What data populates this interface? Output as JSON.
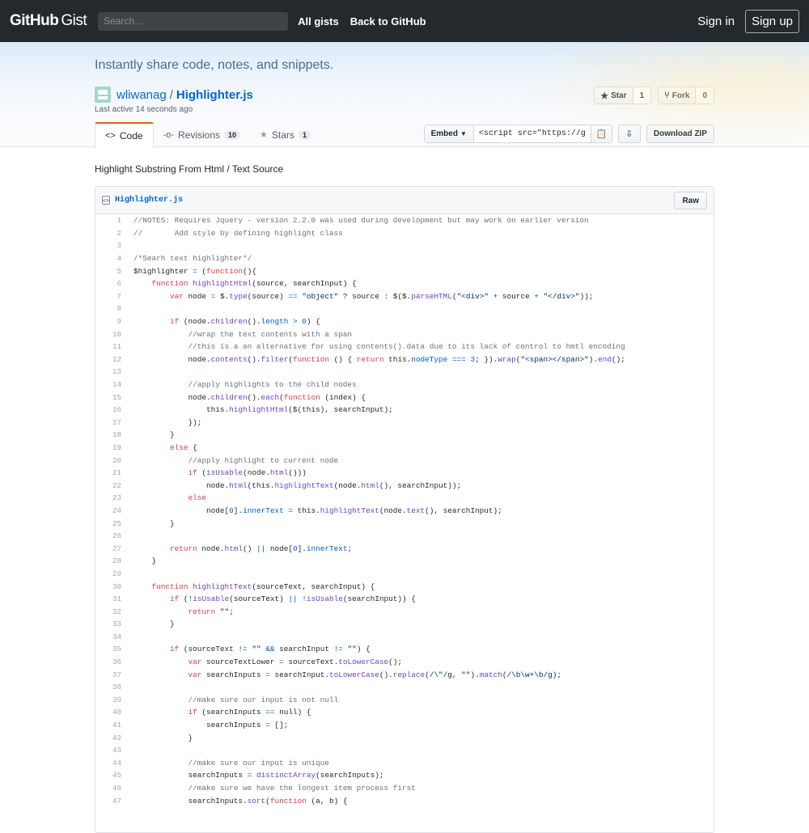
{
  "header": {
    "logo_main": "GitHub",
    "logo_sub": "Gist",
    "search_placeholder": "Search…",
    "nav": [
      "All gists",
      "Back to GitHub"
    ],
    "sign_in": "Sign in",
    "sign_up": "Sign up"
  },
  "hero": {
    "tagline": "Instantly share code, notes, and snippets.",
    "owner": "wliwanag",
    "separator": "/",
    "gist_name": "Highlighter.js",
    "last_active": "Last active 14 seconds ago",
    "star_label": "Star",
    "star_count": "1",
    "fork_label": "Fork",
    "fork_count": "0"
  },
  "tabs": [
    {
      "label": "Code",
      "icon": "code-icon",
      "badge": ""
    },
    {
      "label": "Revisions",
      "icon": "revisions-icon",
      "badge": "10"
    },
    {
      "label": "Stars",
      "icon": "star-icon",
      "badge": "1"
    }
  ],
  "actions": {
    "embed_label": "Embed",
    "embed_value": "<script src=\"https://gist.github.com/wliwanag/",
    "download_zip": "Download ZIP"
  },
  "description": "Highlight Substring From Html / Text Source",
  "file": {
    "name": "Highlighter.js",
    "raw_label": "Raw",
    "lines": [
      "//NOTES: Requires Jquery - version 2.2.0 was used during development but may work on earlier version",
      "//       Add style by defining highlight class",
      "",
      "/*Searh text highlighter*/",
      "$highlighter = (function(){",
      "    function highlightHtml(source, searchInput) {",
      "        var node = $.type(source) == \"object\" ? source : $($.parseHTML(\"<div>\" + source + \"</div>\"));",
      "",
      "        if (node.children().length > 0) {",
      "            //wrap the text contents with a span",
      "            //this is a an alternative for using contents().data due to its lack of control to hmtl encoding",
      "            node.contents().filter(function () { return this.nodeType === 3; }).wrap(\"<span></span>\").end();",
      "",
      "            //apply highlights to the child nodes",
      "            node.children().each(function (index) {",
      "                this.highlightHtml($(this), searchInput);",
      "            });",
      "        }",
      "        else {",
      "            //apply highlight to current node",
      "            if (isUsable(node.html()))",
      "                node.html(this.highlightText(node.html(), searchInput));",
      "            else",
      "                node[0].innerText = this.highlightText(node.text(), searchInput);",
      "        }",
      "",
      "        return node.html() || node[0].innerText;",
      "    }",
      "",
      "    function highlightText(sourceText, searchInput) {",
      "        if (!isUsable(sourceText) || !isUsable(searchInput)) {",
      "            return \"\";",
      "        }",
      "",
      "        if (sourceText != \"\" && searchInput != \"\") {",
      "            var sourceTextLower = sourceText.toLowerCase();",
      "            var searchInputs = searchInput.toLowerCase().replace(/\\\"/g, \"\").match(/\\b\\w+\\b/g);",
      "",
      "            //make sure our input is not null",
      "            if (searchInputs == null) {",
      "                searchInputs = [];",
      "            }",
      "",
      "            //make sure our input is unique",
      "            searchInputs = distinctArray(searchInputs);",
      "            //make sure we have the longest item process first",
      "            searchInputs.sort(function (a, b) {"
    ]
  },
  "colors": {
    "header_bg": "#24292e",
    "link": "#0366d6",
    "tab_accent": "#e36209",
    "comment": "#6a737d",
    "keyword": "#d73a49",
    "function": "#6f42c1",
    "string": "#032f62",
    "constant": "#005cc5"
  }
}
